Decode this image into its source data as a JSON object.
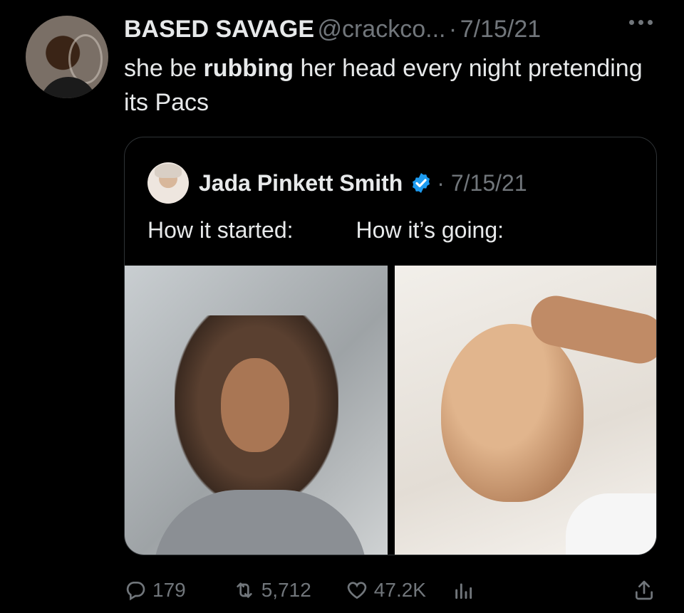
{
  "tweet": {
    "author_name": "BASED SAVAGE",
    "handle": "@crackco...",
    "separator": "·",
    "date": "7/15/21",
    "text_before": "she be ",
    "text_bold": "rubbing",
    "text_after": " her head every night pretending its Pacs"
  },
  "quoted_tweet": {
    "author_name": "Jada Pinkett Smith",
    "separator": "·",
    "date": "7/15/21",
    "text_left": "How it started:",
    "text_right": "How it’s going:",
    "verified_color": "#1d9bf0"
  },
  "actions": {
    "replies": "179",
    "retweets": "5,712",
    "likes": "47.2K"
  },
  "icons": [
    "more-icon",
    "verified-icon",
    "reply-icon",
    "retweet-icon",
    "like-icon",
    "views-icon",
    "share-icon"
  ]
}
